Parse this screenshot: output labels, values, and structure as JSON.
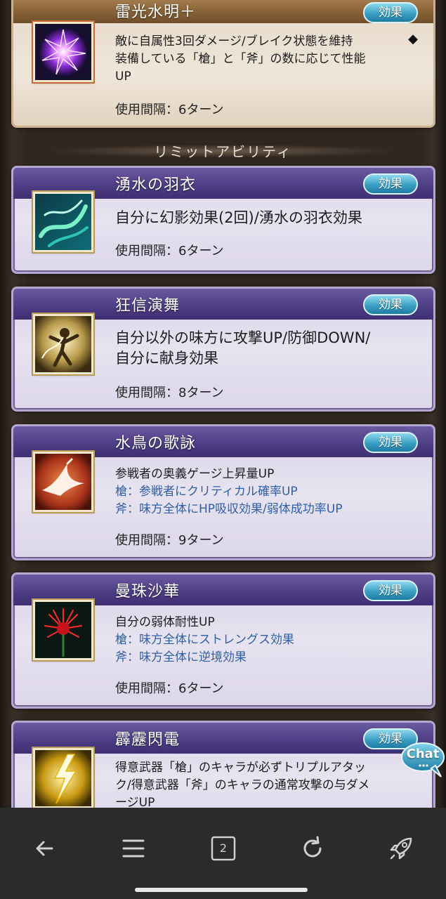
{
  "sections": {
    "limit_ability_label": "リミットアビリティ"
  },
  "abilities": [
    {
      "name": "雷光水明＋",
      "effect_label": "効果",
      "desc_lines": [
        {
          "text": "敵に自属性3回ダメージ/ブレイク状態を維持",
          "style": "normal"
        },
        {
          "text": "装備している「槍」と「斧」の数に応じて性能",
          "style": "normal"
        },
        {
          "text": "UP",
          "style": "normal"
        }
      ],
      "cooldown": "使用間隔：6ターン",
      "icon": "lightning-orb-icon"
    },
    {
      "name": "湧水の羽衣",
      "effect_label": "効果",
      "desc_lines": [
        {
          "text": "自分に幻影効果(2回)/湧水の羽衣効果",
          "style": "normal"
        }
      ],
      "cooldown": "使用間隔：6ターン",
      "icon": "water-veil-icon"
    },
    {
      "name": "狂信演舞",
      "effect_label": "効果",
      "desc_lines": [
        {
          "text": "自分以外の味方に攻撃UP/防御DOWN/",
          "style": "normal"
        },
        {
          "text": "自分に献身効果",
          "style": "normal"
        }
      ],
      "cooldown": "使用間隔：8ターン",
      "icon": "dancer-icon"
    },
    {
      "name": "水鳥の歌詠",
      "effect_label": "効果",
      "desc_lines": [
        {
          "text": "参戦者の奥義ゲージ上昇量UP",
          "style": "normal"
        },
        {
          "text": "槍：参戦者にクリティカル確率UP",
          "style": "blue"
        },
        {
          "text": "斧：味方全体にHP吸収効果/弱体成功率UP",
          "style": "blue"
        }
      ],
      "cooldown": "使用間隔：9ターン",
      "icon": "crane-icon"
    },
    {
      "name": "曼珠沙華",
      "effect_label": "効果",
      "desc_lines": [
        {
          "text": "自分の弱体耐性UP",
          "style": "normal"
        },
        {
          "text": "槍：味方全体にストレングス効果",
          "style": "blue"
        },
        {
          "text": "斧：味方全体に逆境効果",
          "style": "blue"
        }
      ],
      "cooldown": "使用間隔：6ターン",
      "icon": "red-spider-lily-icon"
    },
    {
      "name": "霹靂閃電",
      "effect_label": "効果",
      "desc_lines": [
        {
          "text": "得意武器「槍」のキャラが必ずトリプルアタッ",
          "style": "normal"
        },
        {
          "text": "ク/得意武器「斧」のキャラの通常攻撃の与ダメ",
          "style": "normal"
        },
        {
          "text": "ージUP",
          "style": "normal"
        }
      ],
      "icon": "thunderbolt-icon"
    }
  ],
  "chat": {
    "label": "Chat"
  },
  "navbar": {
    "tab_count": "2",
    "items": [
      "back-icon",
      "menu-icon",
      "tabs-icon",
      "refresh-icon",
      "rocket-icon"
    ]
  }
}
